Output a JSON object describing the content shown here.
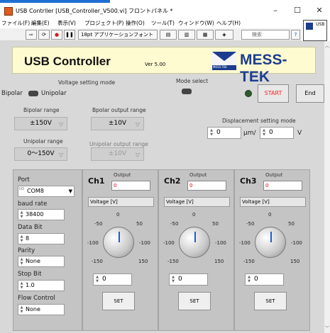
{
  "window": {
    "title": "USB Contrller [USB_Controller_V500.vi] フロントパネル *",
    "minimize": "–",
    "maximize": "☐",
    "close": "✕"
  },
  "menu": [
    "ファイル(F)",
    "編集(E)",
    "表示(V)",
    "プロジェクト(P)",
    "操作(O)",
    "ツール(T)",
    "ウィンドウ(W)",
    "ヘルプ(H)"
  ],
  "toolbar": {
    "run": "⇨",
    "run_continuous": "⟳",
    "abort": "●",
    "pause": "❚❚",
    "font": "18pt アプリケーションフォント",
    "search_placeholder": "検索",
    "help": "?",
    "usb_label": "USB"
  },
  "header": {
    "title": "USB Controller",
    "version": "Ver 5.00",
    "logo": "MESS-TEK",
    "logo_mark_label": "MESS-TEK"
  },
  "voltage_mode": {
    "label": "Voltage setting mode",
    "left": "Bipolar",
    "right": "Unipolar"
  },
  "mode_select": {
    "label": "Mode select"
  },
  "buttons": {
    "start": "START",
    "end": "End"
  },
  "ranges": {
    "bipolar_range_label": "Bipolar range",
    "bipolar_range": "±150V",
    "bipolar_output_label": "Bpolar output range",
    "bipolar_output": "±10V",
    "unipolar_range_label": "Unipolar range",
    "unipolar_range": "0～150V",
    "unipolar_output_label": "Unipolar output range",
    "unipolar_output": "±10V"
  },
  "displacement": {
    "label": "Displacement setting mode",
    "value1": "0",
    "unit1": "μm/",
    "value2": "0",
    "unit2": "V"
  },
  "port": {
    "port_label": "Port",
    "port_value": "COM8",
    "baud_label": "baud rate",
    "baud_value": "38400",
    "databit_label": "Data Bit",
    "databit_value": "8",
    "parity_label": "Parity",
    "parity_value": "None",
    "stopbit_label": "Stop Bit",
    "stopbit_value": "1.0",
    "flow_label": "Flow Control",
    "flow_value": "None"
  },
  "channels": [
    {
      "name": "Ch1",
      "output_label": "Output",
      "output": "0",
      "mode": "Voltage [V]",
      "value": "0",
      "set": "SET",
      "level_v": 0
    },
    {
      "name": "Ch2",
      "output_label": "Output",
      "output": "0",
      "mode": "Voltage [V]",
      "value": "0",
      "set": "SET",
      "level_v": 0
    },
    {
      "name": "Ch3",
      "output_label": "Output",
      "output": "0",
      "mode": "Voltage [V]",
      "value": "0",
      "set": "SET",
      "level_v": 0
    }
  ],
  "knob_ticks": [
    "-50",
    "0",
    "50",
    "-100",
    "-100",
    "-150",
    "150"
  ],
  "colors": {
    "header_bg": "#fffbd0",
    "brand": "#1c3d8f",
    "start_text": "#ff2020",
    "needle": "#1a5cd8",
    "led_off": "#2e5a2e"
  }
}
